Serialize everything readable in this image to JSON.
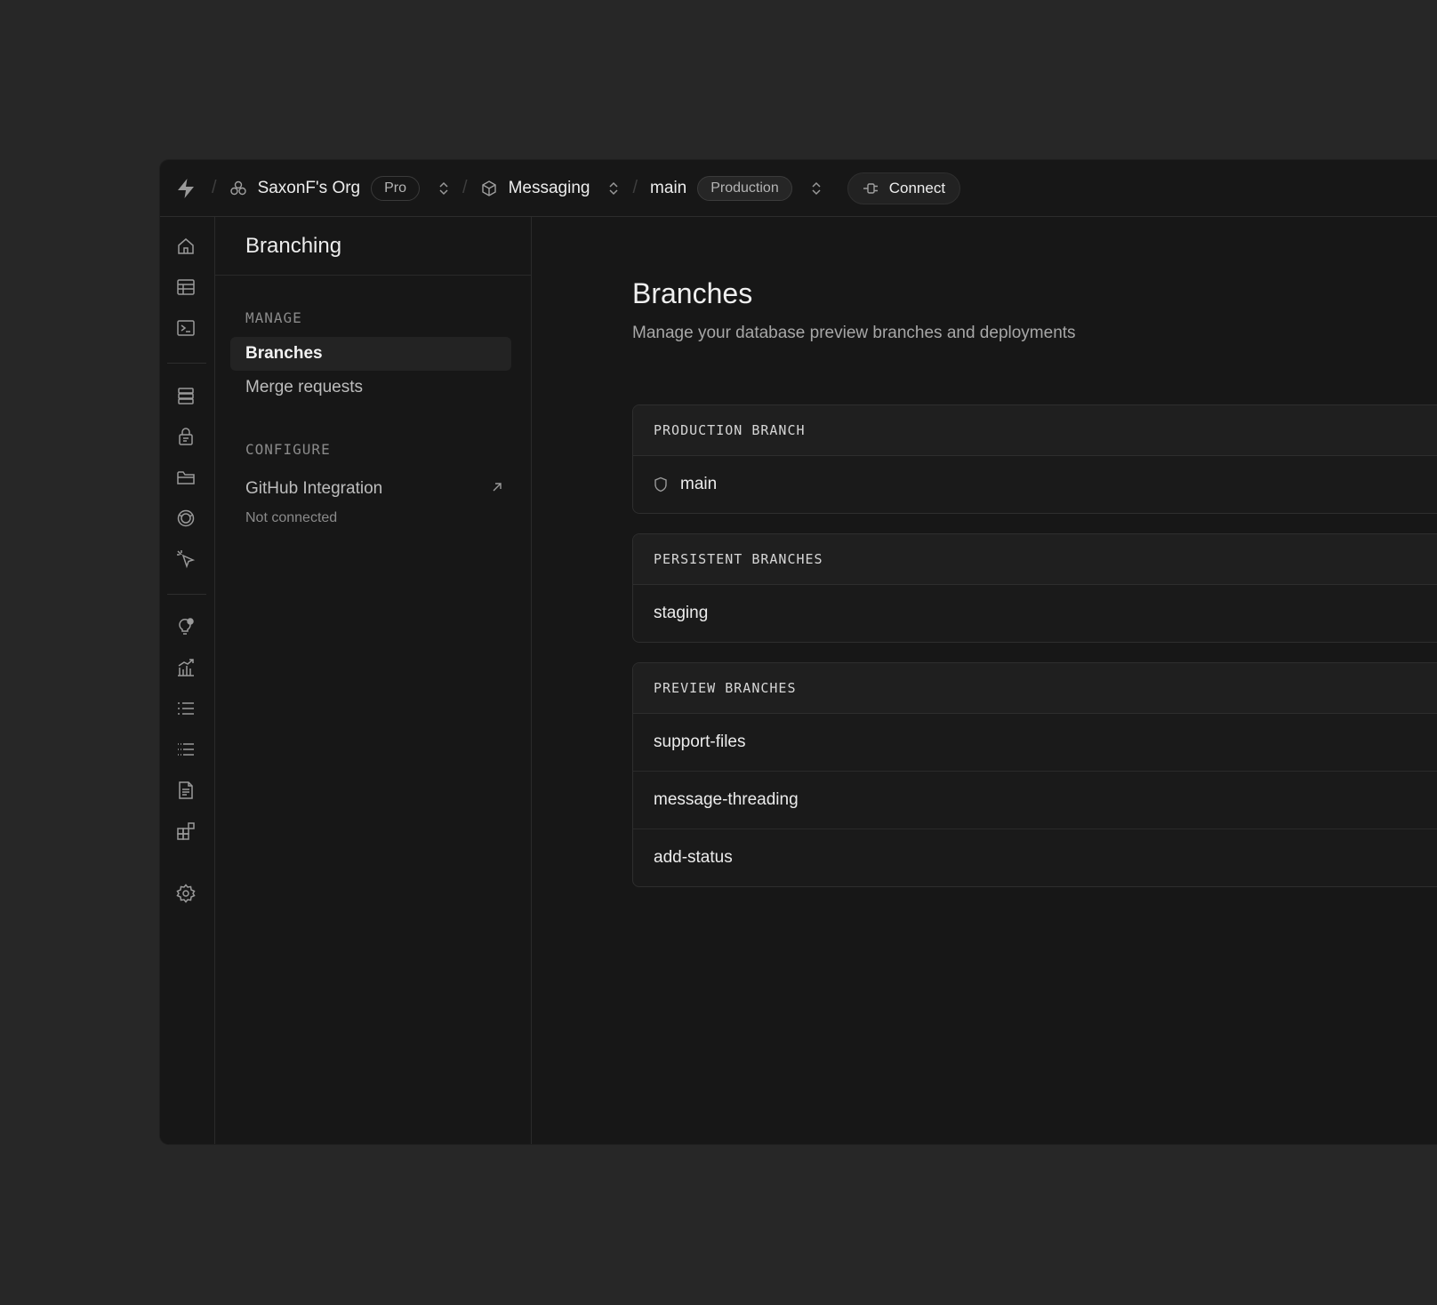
{
  "topbar": {
    "org_name": "SaxonF's Org",
    "org_plan": "Pro",
    "project_name": "Messaging",
    "branch_name": "main",
    "branch_env": "Production",
    "connect_label": "Connect"
  },
  "rail": {
    "icons": [
      "home-icon",
      "table-editor-icon",
      "sql-editor-icon",
      "database-icon",
      "auth-icon",
      "storage-icon",
      "realtime-icon",
      "edge-functions-icon",
      "advisors-icon",
      "reports-icon",
      "logs-icon",
      "api-docs-icon",
      "docs-icon",
      "integrations-icon",
      "settings-icon"
    ]
  },
  "sidebar": {
    "title": "Branching",
    "manage_label": "MANAGE",
    "items": [
      {
        "label": "Branches",
        "active": true
      },
      {
        "label": "Merge requests",
        "active": false
      }
    ],
    "configure_label": "CONFIGURE",
    "github": {
      "label": "GitHub Integration",
      "status": "Not connected"
    }
  },
  "main": {
    "title": "Branches",
    "subtitle": "Manage your database preview branches and deployments",
    "production": {
      "header": "PRODUCTION BRANCH",
      "branches": [
        "main"
      ]
    },
    "persistent": {
      "header": "PERSISTENT BRANCHES",
      "branches": [
        "staging"
      ]
    },
    "preview": {
      "header": "PREVIEW BRANCHES",
      "branches": [
        "support-files",
        "message-threading",
        "add-status"
      ]
    }
  }
}
